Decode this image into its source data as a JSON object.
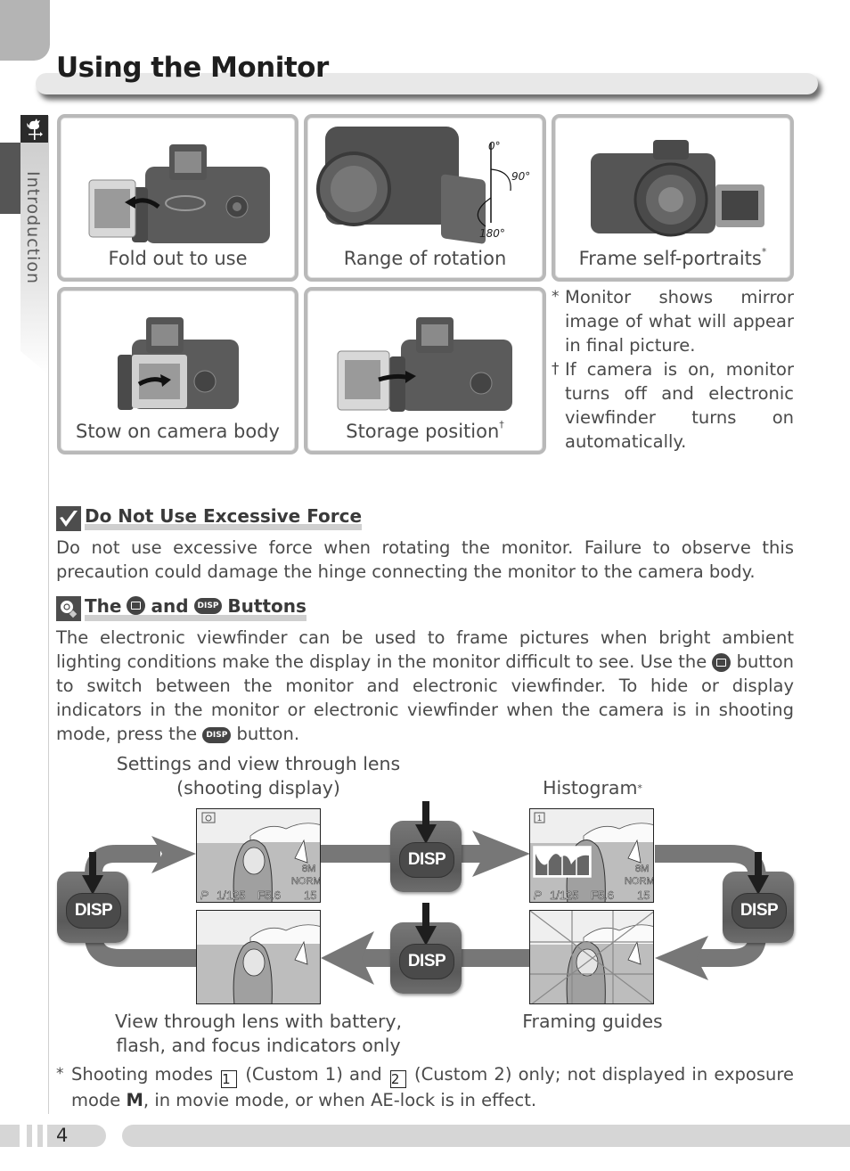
{
  "page": {
    "title": "Using the Monitor",
    "section_tab": "Introduction",
    "page_number": "4"
  },
  "cards": [
    {
      "caption": "Fold out to use",
      "mark": ""
    },
    {
      "caption": "Range of rotation",
      "mark": "",
      "angles": [
        "0°",
        "90°",
        "180°"
      ]
    },
    {
      "caption": "Frame self-portraits",
      "mark": "*"
    },
    {
      "caption": "Stow on camera body",
      "mark": ""
    },
    {
      "caption": "Storage position",
      "mark": "†"
    }
  ],
  "notes": [
    {
      "mark": "*",
      "text": "Monitor shows mirror image of what will appear in final picture."
    },
    {
      "mark": "†",
      "text": "If camera is on, monitor turns off and electronic viewfinder turns on automatically."
    }
  ],
  "sections": {
    "force": {
      "heading": "Do Not Use Excessive Force",
      "body": "Do not use excessive force when rotating the monitor.  Failure to observe this precaution could damage the hinge connecting the monitor to the camera body."
    },
    "buttons": {
      "heading_pre": "The",
      "heading_mid": "and",
      "heading_post": "Buttons",
      "disp_label": "DISP",
      "body_1": "The electronic viewfinder can be used to frame pictures when bright ambient lighting conditions make the display in the monitor difficult to see.  Use the",
      "body_2": "button to switch between the monitor and electronic viewfinder.  To hide or display indicators in the monitor or electronic viewfinder when the camera is in shooting mode, press the",
      "body_3": "button."
    }
  },
  "diagram": {
    "labels": {
      "shooting": "Settings and view through lens (shooting display)",
      "histogram": "Histogram",
      "histogram_mark": "*",
      "battery": "View through lens with battery, flash, and focus indicators only",
      "framing": "Framing guides"
    },
    "button_label": "DISP",
    "screen_readout": {
      "mode": "P",
      "shutter": "1/125",
      "aperture": "F5.6",
      "frames": "15",
      "size": "8M",
      "quality": "NORM"
    }
  },
  "footnote": {
    "mark": "*",
    "pre": "Shooting modes",
    "custom1_num": "1",
    "custom1_text": "(Custom 1) and",
    "custom2_num": "2",
    "custom2_text": "(Custom 2) only; not displayed in exposure mode",
    "mode_m": "M",
    "post": ", in movie mode, or when AE-lock is in effect."
  }
}
